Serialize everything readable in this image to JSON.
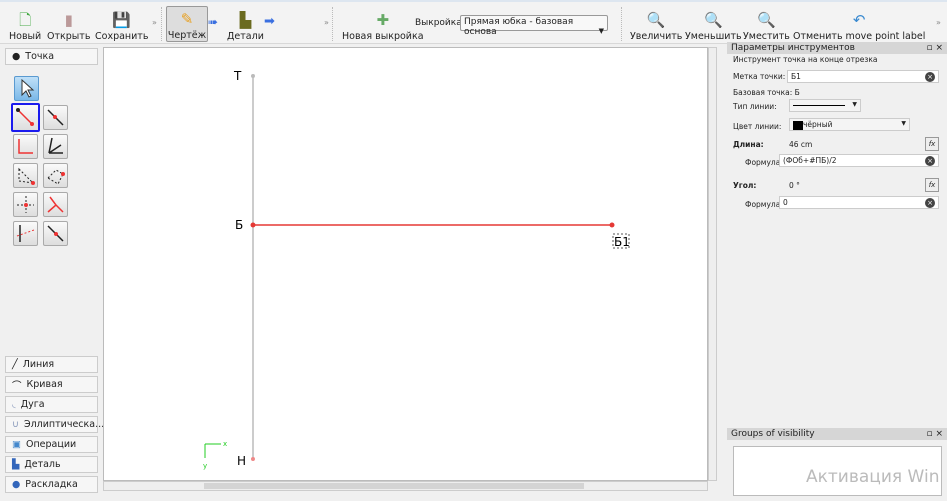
{
  "toolbar": {
    "new": "Новый",
    "open": "Открыть",
    "save": "Сохранить",
    "draft": "Чертёж",
    "details": "Детали",
    "new_pattern": "Новая выкройка",
    "pattern_label": "Выкройка:",
    "pattern_value": "Прямая юбка - базовая основа",
    "zoom_in": "Увеличить",
    "zoom_out": "Уменьшить",
    "fit": "Уместить",
    "undo": "Отменить move point label"
  },
  "left": {
    "point_group": "Точка",
    "groups": [
      "Линия",
      "Кривая",
      "Дуга",
      "Эллиптическа...",
      "Операции",
      "Деталь",
      "Раскладка"
    ]
  },
  "canvas": {
    "points": [
      {
        "label": "Т"
      },
      {
        "label": "Б"
      },
      {
        "label": "Н"
      },
      {
        "label": "Б1"
      }
    ],
    "axis_x": "x",
    "axis_y": "y",
    "line_color": "#e53935"
  },
  "panel": {
    "title": "Параметры инструментов",
    "subtitle": "Инструмент точка на конце отрезка",
    "point_label_caption": "Метка точки:",
    "point_label": "Б1",
    "base_point_caption": "Базовая точка:",
    "base_point": "Б",
    "line_type_caption": "Тип линии:",
    "line_color_caption": "Цвет линии:",
    "line_color": "чёрный",
    "length_caption": "Длина:",
    "length_value": "46 cm",
    "formula_caption": "Формула",
    "length_formula": "(ФОб+#ПБ)/2",
    "angle_caption": "Угол:",
    "angle_value": "0 °",
    "angle_formula": "0",
    "fx": "fx"
  },
  "groups_panel": {
    "title": "Groups of visibility"
  },
  "watermark": "Активация Win"
}
